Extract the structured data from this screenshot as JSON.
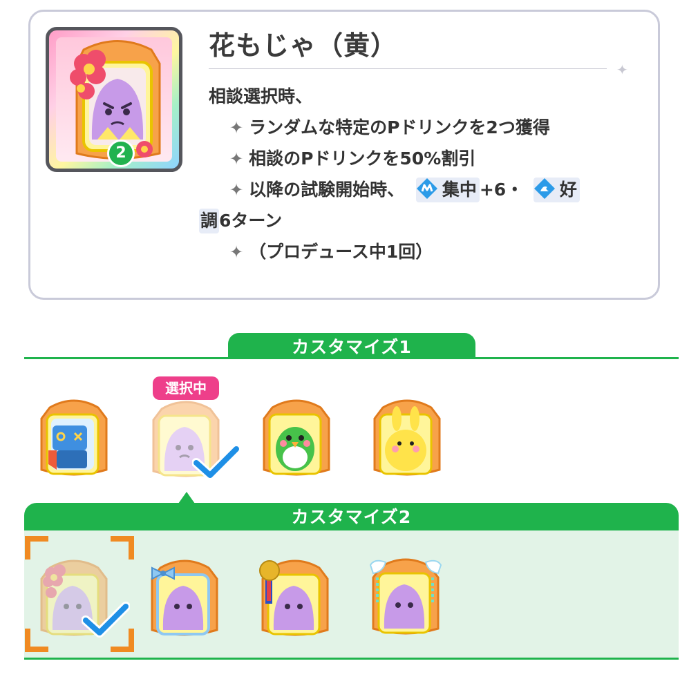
{
  "card": {
    "title": "花もじゃ（黄）",
    "badge_number": "2",
    "lines": [
      "相談選択時、",
      "ランダムな特定のPドリンクを2つ獲得",
      "相談のPドリンクを50%割引",
      "以降の試験開始時、",
      "集中",
      "+6・",
      "好",
      "調",
      "6ターン",
      "（プロデュース中1回）"
    ]
  },
  "sections": {
    "customize1_label": "カスタマイズ1",
    "customize2_label": "カスタマイズ2",
    "selected_label": "選択中"
  },
  "customize1_items": [
    "robot-backpack",
    "purple-fluff-backpack",
    "green-bird-backpack",
    "yellow-bunny-backpack"
  ],
  "customize2_items": [
    "flower-fluff-backpack",
    "ribbon-fluff-backpack",
    "medal-fluff-backpack",
    "wing-fluff-backpack"
  ],
  "colors": {
    "green": "#1fb34c",
    "pink": "#ee3f8a",
    "check_blue": "#1e8fe6",
    "orange": "#f08a22"
  }
}
